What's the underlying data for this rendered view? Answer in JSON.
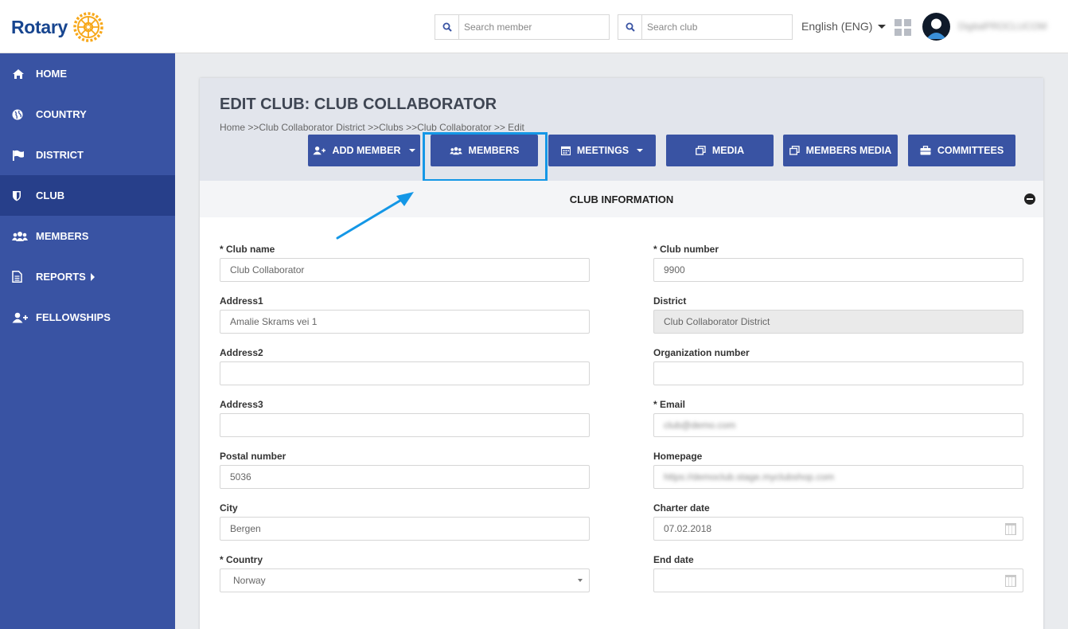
{
  "header": {
    "logo_text": "Rotary",
    "search_member_placeholder": "Search member",
    "search_club_placeholder": "Search club",
    "language": "English (ENG)",
    "username": "DigitalPROCLUCOM"
  },
  "sidebar": {
    "items": [
      {
        "label": "HOME",
        "icon": "home-icon"
      },
      {
        "label": "COUNTRY",
        "icon": "globe-icon"
      },
      {
        "label": "DISTRICT",
        "icon": "flag-icon"
      },
      {
        "label": "CLUB",
        "icon": "shield-icon",
        "active": true
      },
      {
        "label": "MEMBERS",
        "icon": "users-icon"
      },
      {
        "label": "REPORTS",
        "icon": "document-icon"
      },
      {
        "label": "FELLOWSHIPS",
        "icon": "user-plus-icon"
      }
    ]
  },
  "main": {
    "title": "EDIT CLUB: CLUB COLLABORATOR",
    "breadcrumb": "Home >>Club Collaborator District >>Clubs >>Club Collaborator >> Edit",
    "buttons": {
      "add_member": "ADD MEMBER",
      "members": "MEMBERS",
      "meetings": "MEETINGS",
      "media": "MEDIA",
      "members_media": "MEMBERS MEDIA",
      "committees": "COMMITTEES"
    },
    "section_title": "CLUB INFORMATION",
    "form": {
      "club_name": {
        "label": "* Club name",
        "value": "Club Collaborator"
      },
      "address1": {
        "label": "Address1",
        "value": "Amalie Skrams vei 1"
      },
      "address2": {
        "label": "Address2",
        "value": ""
      },
      "address3": {
        "label": "Address3",
        "value": ""
      },
      "postal_number": {
        "label": "Postal number",
        "value": "5036"
      },
      "city": {
        "label": "City",
        "value": "Bergen"
      },
      "country": {
        "label": "* Country",
        "value": "Norway"
      },
      "club_number": {
        "label": "* Club number",
        "value": "9900"
      },
      "district": {
        "label": "District",
        "value": "Club Collaborator District"
      },
      "organization_number": {
        "label": "Organization number",
        "value": ""
      },
      "email": {
        "label": "* Email",
        "value": "club@demo.com"
      },
      "homepage": {
        "label": "Homepage",
        "value": "https://democlub.stage.myclubshop.com"
      },
      "charter_date": {
        "label": "Charter date",
        "value": "07.02.2018"
      },
      "end_date": {
        "label": "End date",
        "value": ""
      }
    }
  },
  "colors": {
    "brand_blue": "#3953a3",
    "sidebar_active": "#273f8a",
    "highlight": "#1497e6",
    "logo_gold": "#f7a81b"
  }
}
